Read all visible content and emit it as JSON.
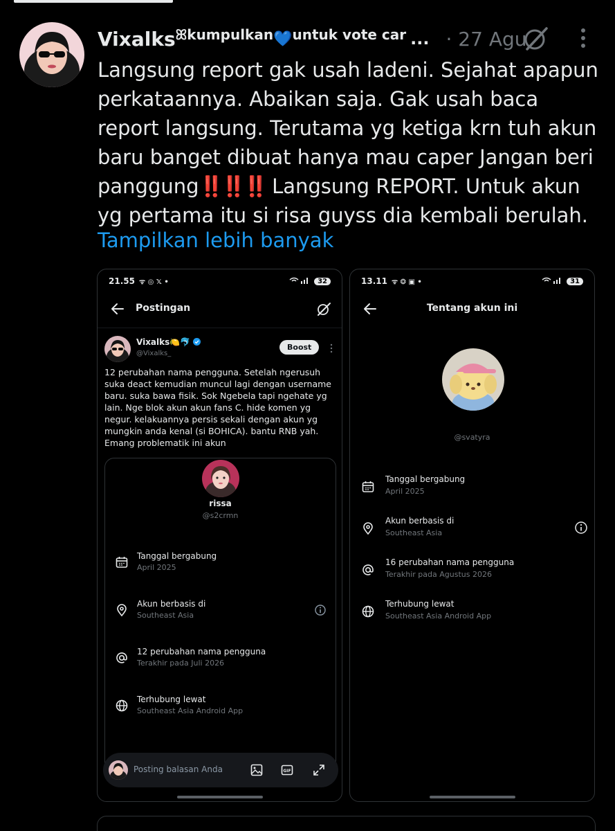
{
  "tweet": {
    "author_name": "Vixalks",
    "author_name_extra": "ꕤkumpulkan",
    "heart": "💙",
    "author_name_tail": "untuk vote car",
    "ellipsis": "...",
    "date": "· 27 Agu",
    "text_part1": "Langsung report gak usah ladeni. Sejahat apapun perkataannya. Abaikan saja. Gak usah baca report langsung. Terutama yg ketiga krn tuh akun baru banget dibuat hanya mau caper Jangan  beri panggung",
    "exclaims": "‼️‼️‼️",
    "text_part2": " Langsung REPORT.  Untuk akun yg pertama itu si risa guyss dia kembali berulah.",
    "show_more": "Tampilkan lebih banyak"
  },
  "left_phone": {
    "time": "21.55",
    "status_icons": "ᯤ ◎ 𝕏 •",
    "battery": "32",
    "nav_title": "Postingan",
    "post": {
      "name": "Vixalks",
      "name_emoji": "🍋🐬",
      "handle": "@Vixalks_",
      "boost": "Boost",
      "text": "12 perubahan nama  pengguna. Setelah ngerusuh suka deact kemudian muncul lagi dengan username baru. suka bawa fisik. Sok Ngebela tapi ngehate yg lain. Nge blok akun akun fans C. hide komen yg negur. kelakuannya persis sekali dengan akun yg mungkin anda kenal (si BOHICA). bantu RNB yah. Emang problematik ini akun"
    },
    "card": {
      "name": "rissa",
      "handle": "@s2crmn",
      "rows": [
        {
          "label": "Tanggal bergabung",
          "sub": "April 2025"
        },
        {
          "label": "Akun berbasis di",
          "sub": "Southeast Asia"
        },
        {
          "label": "12 perubahan nama pengguna",
          "sub": "Terakhir pada Juli 2026"
        },
        {
          "label": "Terhubung lewat",
          "sub": "Southeast Asia Android App"
        }
      ]
    },
    "reply_placeholder": "Posting balasan Anda"
  },
  "right_phone": {
    "time": "13.11",
    "status_icons": "ᯤ ❂ ▣ •",
    "battery": "31",
    "nav_title": "Tentang akun ini",
    "handle": "@svatyra",
    "rows": [
      {
        "label": "Tanggal bergabung",
        "sub": "April 2025"
      },
      {
        "label": "Akun berbasis di",
        "sub": "Southeast Asia"
      },
      {
        "label": "16 perubahan nama pengguna",
        "sub": "Terakhir pada Agustus 2026"
      },
      {
        "label": "Terhubung lewat",
        "sub": "Southeast Asia Android App"
      }
    ]
  },
  "colors": {
    "link": "#1d9bf0",
    "muted": "#71767b",
    "text": "#e7e9ea",
    "border": "#2f3336"
  }
}
